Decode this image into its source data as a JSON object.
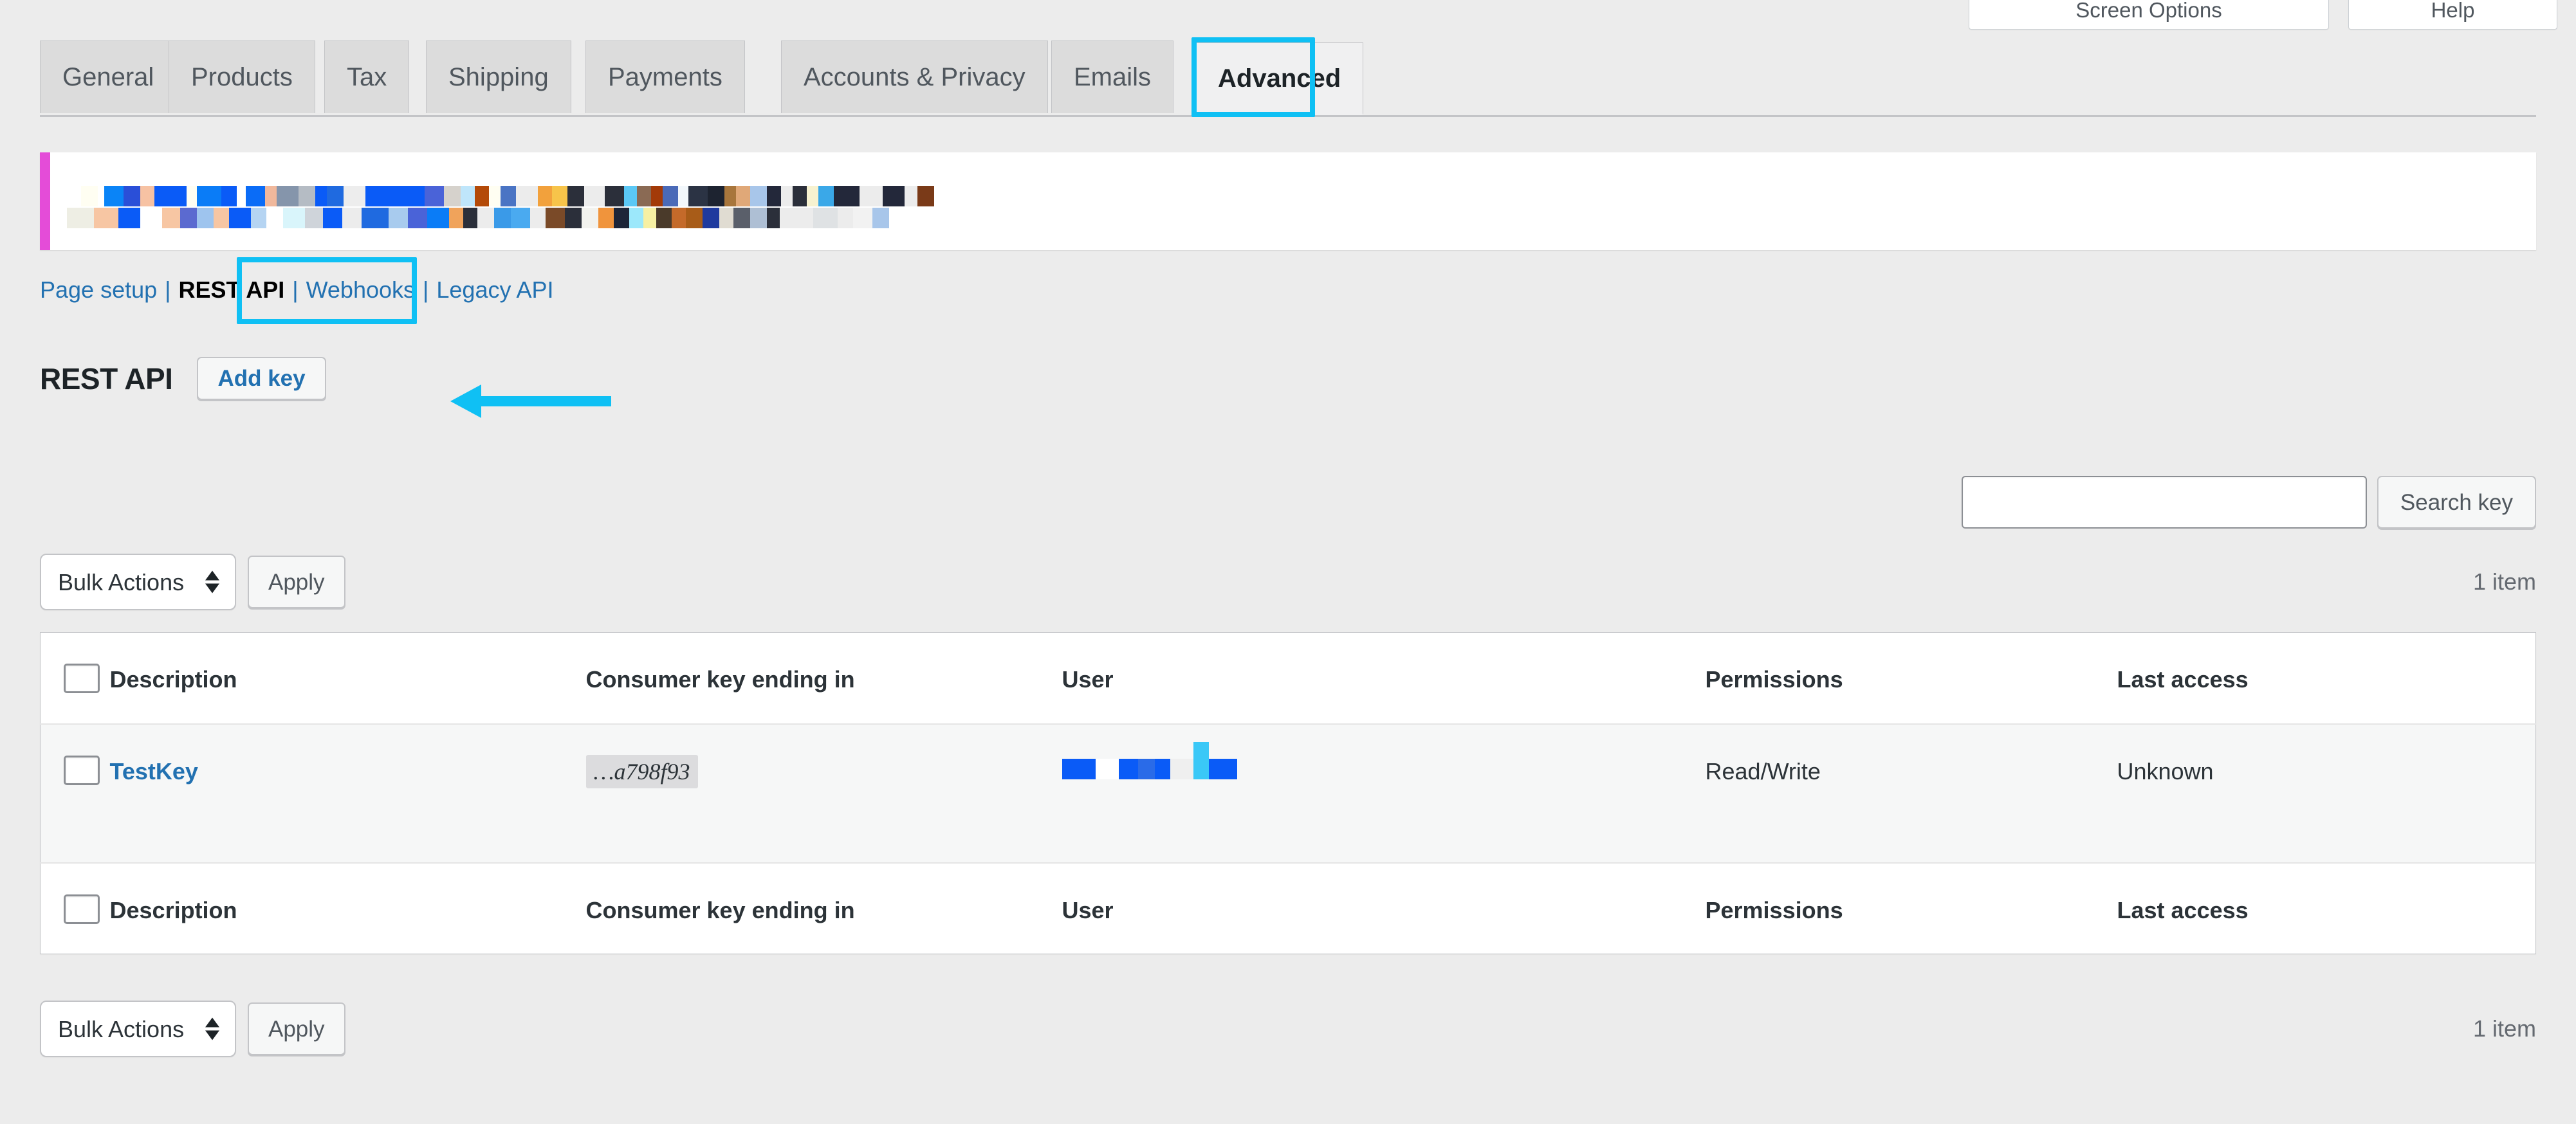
{
  "screen_meta": {
    "screen_options_label": "Screen Options",
    "help_label": "Help"
  },
  "nav_tabs": [
    {
      "label": "General",
      "active": false
    },
    {
      "label": "Products",
      "active": false
    },
    {
      "label": "Tax",
      "active": false
    },
    {
      "label": "Shipping",
      "active": false
    },
    {
      "label": "Payments",
      "active": false
    },
    {
      "label": "Accounts & Privacy",
      "active": false
    },
    {
      "label": "Emails",
      "active": false
    },
    {
      "label": "Advanced",
      "active": true
    }
  ],
  "notice": {
    "redacted": true,
    "accent_color": "#e44cd8"
  },
  "subnav": {
    "items": [
      {
        "label": "Page setup",
        "current": false
      },
      {
        "label": "REST API",
        "current": true
      },
      {
        "label": "Webhooks",
        "current": false
      },
      {
        "label": "Legacy API",
        "current": false
      }
    ],
    "separator": "|"
  },
  "page": {
    "title": "REST API",
    "add_key_label": "Add key"
  },
  "search": {
    "value": "",
    "placeholder": "",
    "submit_label": "Search key"
  },
  "tablenav_top": {
    "bulk_actions_label": "Bulk Actions",
    "apply_label": "Apply",
    "displaying_num": "1 item"
  },
  "tablenav_bottom": {
    "bulk_actions_label": "Bulk Actions",
    "apply_label": "Apply",
    "displaying_num": "1 item"
  },
  "table": {
    "columns": [
      "Description",
      "Consumer key ending in",
      "User",
      "Permissions",
      "Last access"
    ],
    "rows": [
      {
        "description": "TestKey",
        "consumer_key": "…a798f93",
        "user": "",
        "user_redacted": true,
        "permissions": "Read/Write",
        "last_access": "Unknown"
      }
    ]
  },
  "annotations": {
    "highlight_color": "#0fc0f4",
    "arrow_color": "#0fc0f4",
    "highlighted_tab": "Advanced",
    "highlighted_subnav": "REST API",
    "arrow_points_to": "Add key"
  }
}
